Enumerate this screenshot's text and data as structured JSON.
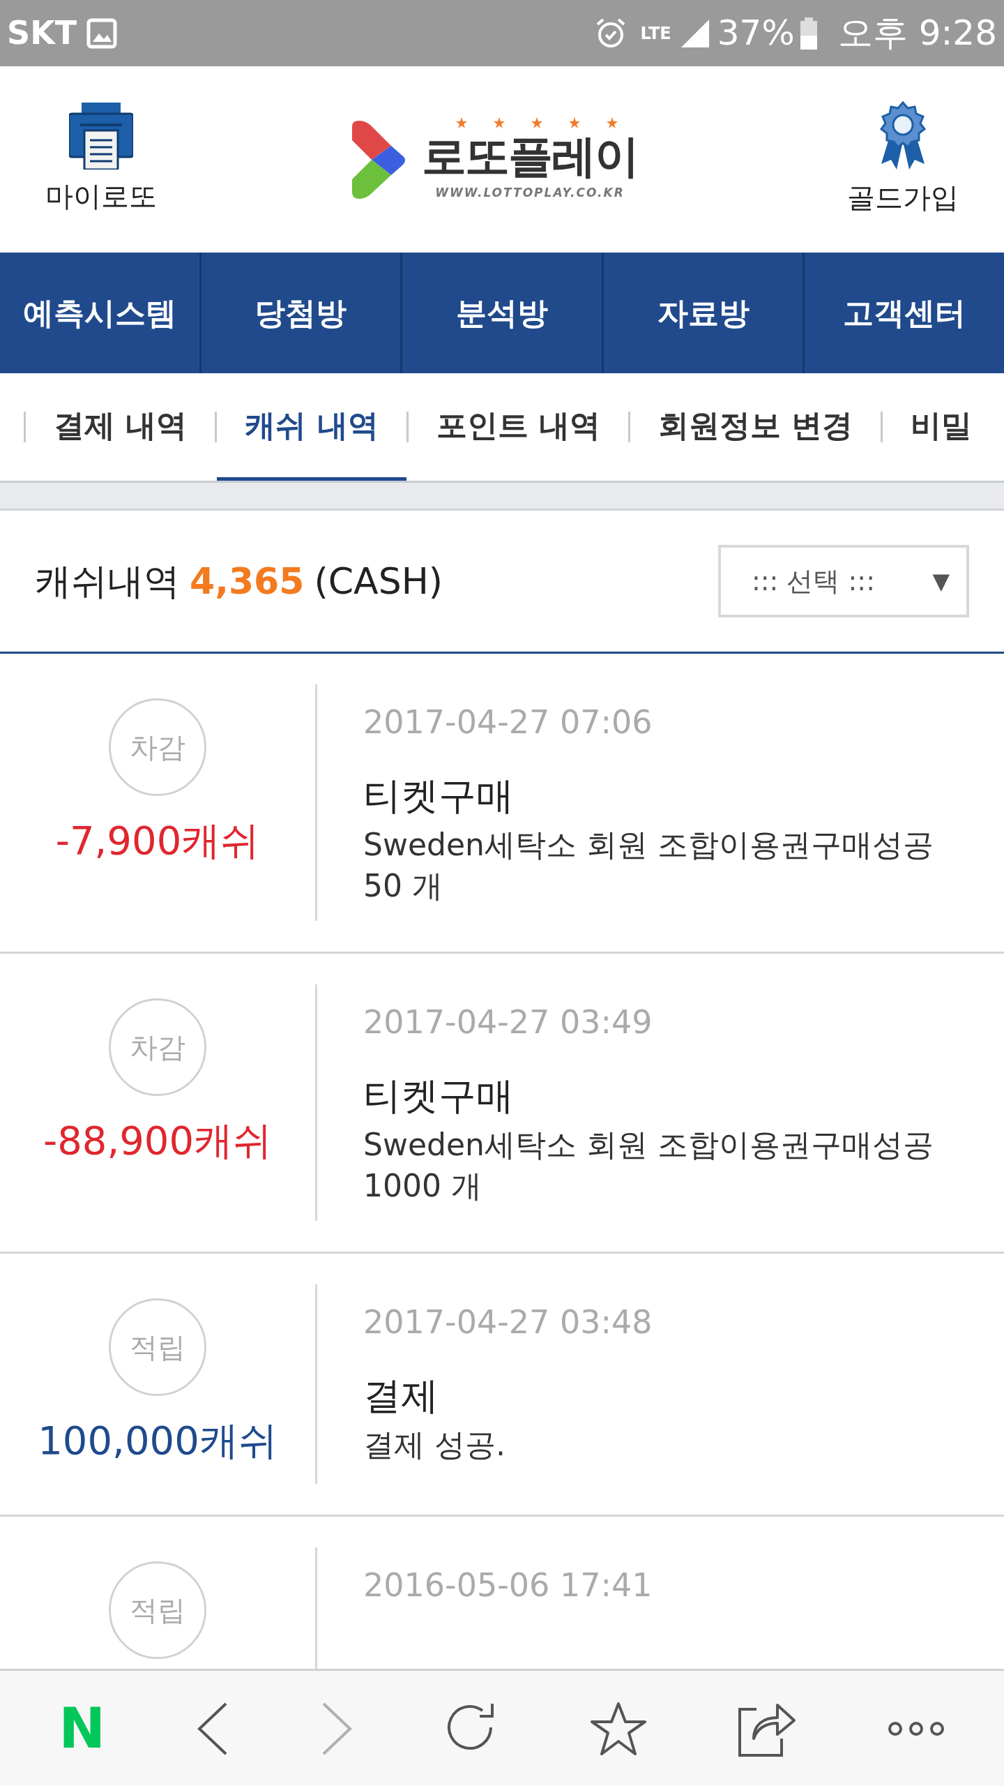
{
  "status_bar": {
    "carrier": "SKT",
    "network": "LTE",
    "battery": "37%",
    "time": "오후 9:28"
  },
  "header": {
    "left_link": "마이로또",
    "logo_title": "로또플레이",
    "logo_url": "WWW.LOTTOPLAY.CO.KR",
    "right_link": "골드가입"
  },
  "main_nav": [
    {
      "label": "예측시스템"
    },
    {
      "label": "당첨방"
    },
    {
      "label": "분석방"
    },
    {
      "label": "자료방"
    },
    {
      "label": "고객센터"
    }
  ],
  "sub_nav": [
    {
      "label": "결제 내역",
      "selected": false
    },
    {
      "label": "캐쉬 내역",
      "selected": true
    },
    {
      "label": "포인트 내역",
      "selected": false
    },
    {
      "label": "회원정보 변경",
      "selected": false
    },
    {
      "label": "비밀",
      "selected": false
    }
  ],
  "summary": {
    "label": "캐쉬내역",
    "amount": "4,365",
    "unit": "(CASH)",
    "select": "::: 선택 :::",
    "select_arrow": "▼"
  },
  "entries": [
    {
      "kind": "deduct",
      "badge": "차감",
      "amount": "-7,900캐쉬",
      "date": "2017-04-27 07:06",
      "title": "티켓구매",
      "desc": "Sweden세탁소 회원 조합이용권구매성공 50 개"
    },
    {
      "kind": "deduct",
      "badge": "차감",
      "amount": "-88,900캐쉬",
      "date": "2017-04-27 03:49",
      "title": "티켓구매",
      "desc": "Sweden세탁소 회원 조합이용권구매성공 1000 개"
    },
    {
      "kind": "earn",
      "badge": "적립",
      "amount": "100,000캐쉬",
      "date": "2017-04-27 03:48",
      "title": "결제",
      "desc": "결제 성공."
    },
    {
      "kind": "earn",
      "badge": "적립",
      "date": "2016-05-06 17:41"
    }
  ],
  "browser_toolbar": [
    {
      "kind": "home",
      "label": "N",
      "disabled": false
    },
    {
      "kind": "back",
      "disabled": false
    },
    {
      "kind": "forward",
      "disabled": true
    },
    {
      "kind": "reload",
      "disabled": false
    },
    {
      "kind": "bookmark",
      "disabled": false
    },
    {
      "kind": "share",
      "disabled": false
    },
    {
      "kind": "more",
      "disabled": false
    }
  ]
}
